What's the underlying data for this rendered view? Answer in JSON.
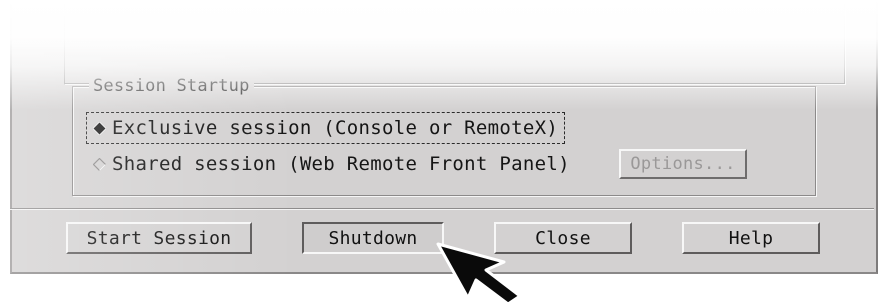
{
  "session_startup": {
    "title": "Session Startup",
    "options": [
      {
        "label": "Exclusive session (Console or RemoteX)",
        "selected": true
      },
      {
        "label": "Shared session (Web Remote Front Panel)",
        "selected": false
      }
    ],
    "options_button": {
      "label": "Options...",
      "enabled": false
    }
  },
  "buttons": {
    "start_session": "Start Session",
    "shutdown": "Shutdown",
    "close": "Close",
    "help": "Help"
  },
  "colors": {
    "panel": "#d3d1d1",
    "disabled_text": "#9a9898",
    "text": "#111111"
  },
  "icons": {
    "selected_radio": "filled-diamond-icon",
    "unselected_radio": "hollow-diamond-icon",
    "cursor": "arrow-cursor-icon"
  }
}
